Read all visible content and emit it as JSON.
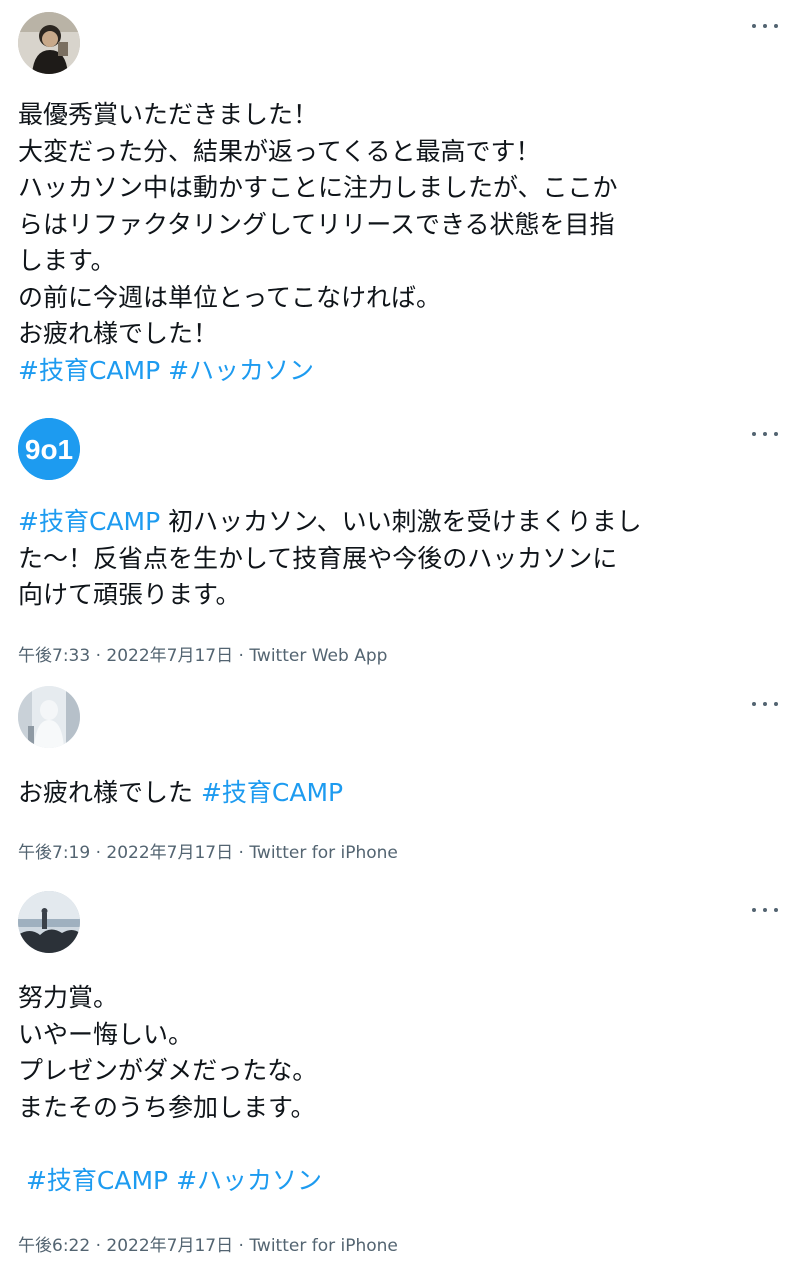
{
  "tweets": [
    {
      "avatar_icon": "user-photo-avatar",
      "lines": [
        "最優秀賞いただきました！",
        "大変だった分、結果が返ってくると最高です！",
        "ハッカソン中は動かすことに注力しましたが、ここか",
        "らはリファクタリングしてリリースできる状態を目指",
        "します。",
        "の前に今週は単位とってこなければ。",
        "お疲れ様でした！"
      ],
      "hashtags": [
        "#技育CAMP",
        "#ハッカソン"
      ]
    },
    {
      "avatar_icon": "logo-avatar",
      "avatar_text": "9o1",
      "hashtag": "#技育CAMP",
      "lines": [
        " 初ハッカソン、いい刺激を受けまくりまし",
        "た～！反省点を生かして技育展や今後のハッカソンに",
        "向けて頑張ります。"
      ],
      "time": "午後7:33",
      "separator": "·",
      "date": "2022年7月17日",
      "source": "Twitter Web App"
    },
    {
      "avatar_icon": "user-photo-avatar",
      "text": "お疲れ様でした ",
      "hashtag": "#技育CAMP",
      "time": "午後7:19",
      "separator": "·",
      "date": "2022年7月17日",
      "source": "Twitter for iPhone"
    },
    {
      "avatar_icon": "user-photo-avatar",
      "lines": [
        "努力賞。",
        "いやー悔しい。",
        "プレゼンがダメだったな。",
        "またそのうち参加します。"
      ],
      "hashtags": [
        "#技育CAMP",
        "#ハッカソン"
      ],
      "time": "午後6:22",
      "separator": "·",
      "date": "2022年7月17日",
      "source": "Twitter for iPhone"
    }
  ],
  "colors": {
    "hashtag": "#1d9bf0",
    "meta": "#536471",
    "text": "#0f1419",
    "logo_bg": "#1d9bf0"
  }
}
